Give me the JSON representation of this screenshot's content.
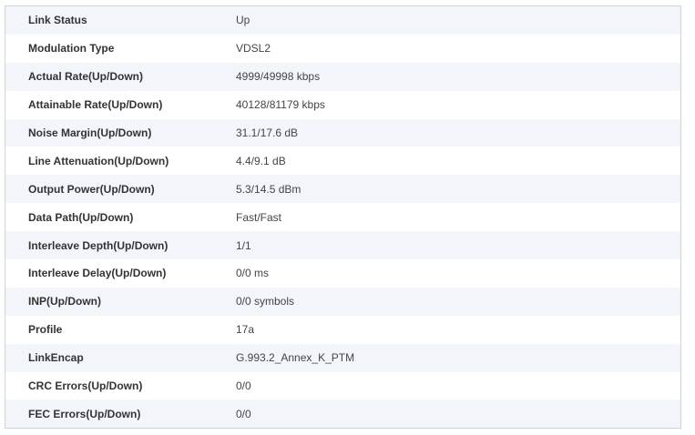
{
  "dsl_status": {
    "rows": [
      {
        "label": "Link Status",
        "value": "Up"
      },
      {
        "label": "Modulation Type",
        "value": "VDSL2"
      },
      {
        "label": "Actual Rate(Up/Down)",
        "value": "4999/49998 kbps"
      },
      {
        "label": "Attainable Rate(Up/Down)",
        "value": "40128/81179 kbps"
      },
      {
        "label": "Noise Margin(Up/Down)",
        "value": "31.1/17.6 dB"
      },
      {
        "label": "Line Attenuation(Up/Down)",
        "value": "4.4/9.1 dB"
      },
      {
        "label": "Output Power(Up/Down)",
        "value": "5.3/14.5 dBm"
      },
      {
        "label": "Data Path(Up/Down)",
        "value": "Fast/Fast"
      },
      {
        "label": "Interleave Depth(Up/Down)",
        "value": "1/1"
      },
      {
        "label": "Interleave Delay(Up/Down)",
        "value": "0/0 ms"
      },
      {
        "label": "INP(Up/Down)",
        "value": "0/0 symbols"
      },
      {
        "label": "Profile",
        "value": "17a"
      },
      {
        "label": "LinkEncap",
        "value": "G.993.2_Annex_K_PTM"
      },
      {
        "label": "CRC Errors(Up/Down)",
        "value": "0/0"
      },
      {
        "label": "FEC Errors(Up/Down)",
        "value": "0/0"
      }
    ]
  }
}
